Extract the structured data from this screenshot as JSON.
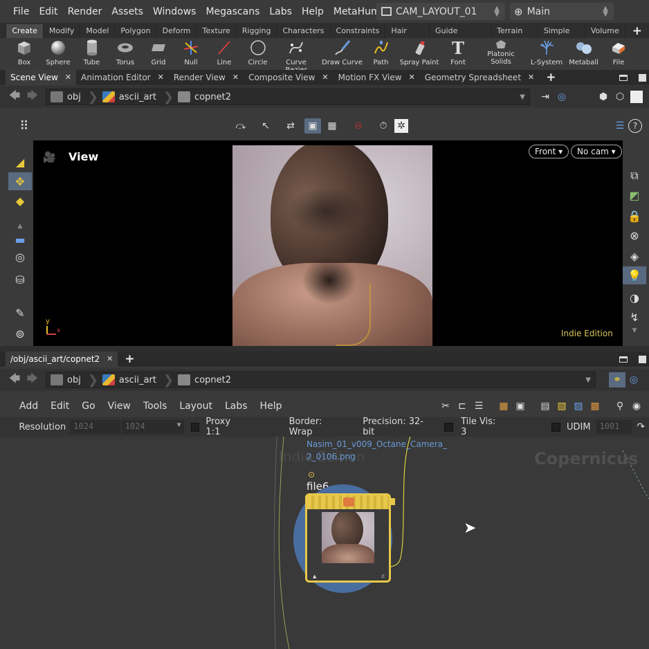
{
  "menubar": {
    "items": [
      "File",
      "Edit",
      "Render",
      "Assets",
      "Windows",
      "Megascans",
      "Labs",
      "Help",
      "MetaHuman"
    ],
    "desktop": "CAM_LAYOUT_01",
    "context": "Main"
  },
  "shelf_tabs": [
    "Create",
    "Modify",
    "Model",
    "Polygon",
    "Deform",
    "Texture",
    "Rigging",
    "Characters",
    "Constraints",
    "Hair Utils",
    "Guide Process",
    "Terrain FX",
    "Simple FX",
    "Volume"
  ],
  "shelf_tools": [
    {
      "label": "Box",
      "icon": "box-icon"
    },
    {
      "label": "Sphere",
      "icon": "sphere-icon"
    },
    {
      "label": "Tube",
      "icon": "tube-icon"
    },
    {
      "label": "Torus",
      "icon": "torus-icon"
    },
    {
      "label": "Grid",
      "icon": "grid-icon"
    },
    {
      "label": "Null",
      "icon": "null-icon"
    },
    {
      "label": "Line",
      "icon": "line-icon"
    },
    {
      "label": "Circle",
      "icon": "circle-icon"
    },
    {
      "label": "Curve Bezier",
      "icon": "curve-bezier-icon"
    },
    {
      "label": "Draw Curve",
      "icon": "draw-curve-icon"
    },
    {
      "label": "Path",
      "icon": "path-icon"
    },
    {
      "label": "Spray Paint",
      "icon": "spray-paint-icon"
    },
    {
      "label": "Font",
      "icon": "font-icon"
    },
    {
      "label": "Platonic Solids",
      "icon": "platonic-solids-icon"
    },
    {
      "label": "L-System",
      "icon": "lsystem-icon"
    },
    {
      "label": "Metaball",
      "icon": "metaball-icon"
    },
    {
      "label": "File",
      "icon": "file-icon"
    }
  ],
  "top_pane": {
    "tabs": [
      "Scene View",
      "Animation Editor",
      "Render View",
      "Composite View",
      "Motion FX View",
      "Geometry Spreadsheet"
    ],
    "path": [
      "obj",
      "ascii_art",
      "copnet2"
    ],
    "viewport": {
      "label": "View",
      "camera_view": "Front",
      "camera": "No cam",
      "edition": "Indie Edition",
      "axis_y": "y",
      "axis_x": "x"
    }
  },
  "bottom_pane": {
    "tab": "/obj/ascii_art/copnet2",
    "path": [
      "obj",
      "ascii_art",
      "copnet2"
    ],
    "menu": [
      "Add",
      "Edit",
      "Go",
      "View",
      "Tools",
      "Layout",
      "Labs",
      "Help"
    ],
    "params": {
      "resolution_label": "Resolution",
      "res_x": "1024",
      "res_y": "1024",
      "proxy": "Proxy 1:1",
      "border": "Border: Wrap",
      "precision": "Precision: 32-bit",
      "tile_vis": "Tile Vis: 3",
      "udim_label": "UDIM",
      "udim_value": "1001"
    },
    "network": {
      "watermark_left": "Indie Edition",
      "watermark_right": "Copernicus",
      "node_file_line1": "Nasim_01_v009_Octane_Camera_",
      "node_file_line2": "2_0106.png",
      "node_name": "file6"
    }
  },
  "colors": {
    "accent_blue": "#4a86c8",
    "node_yellow": "#e8c84a",
    "node_disc": "#4a6da0",
    "edition_yellow": "#d8c65a"
  }
}
